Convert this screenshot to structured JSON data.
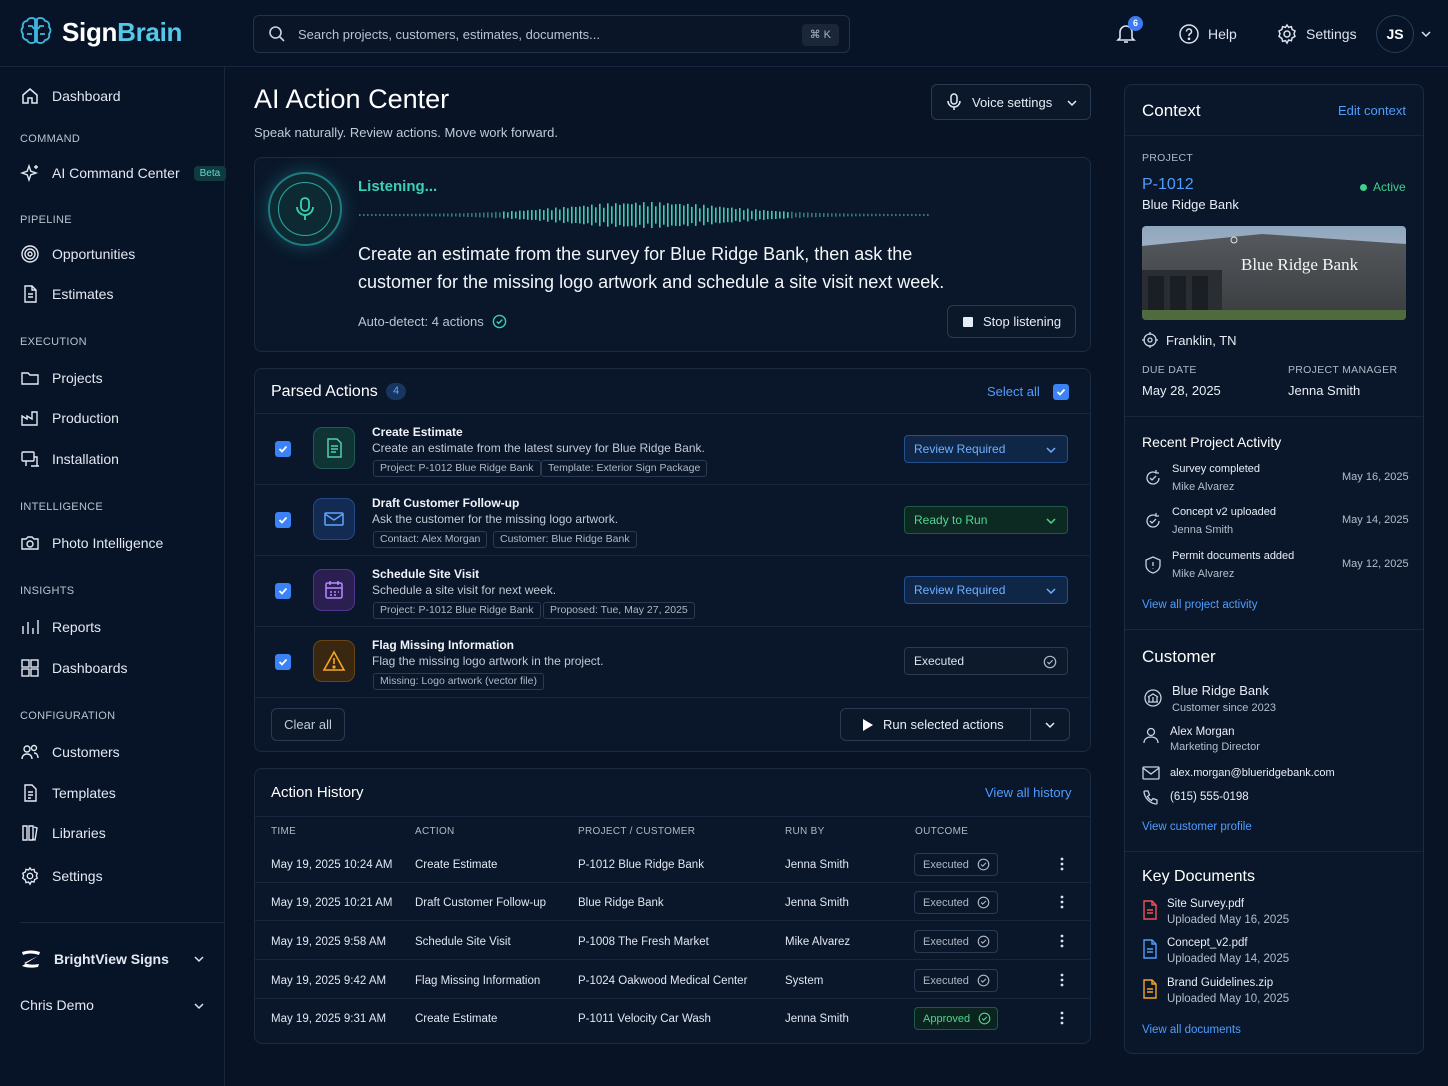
{
  "brand": {
    "name_part1": "Sign",
    "name_part2": "Brain"
  },
  "topbar": {
    "search_placeholder": "Search projects, customers, estimates, documents...",
    "search_shortcut": "⌘ K",
    "notifications_count": "6",
    "help_label": "Help",
    "settings_label": "Settings",
    "user_initials": "JS"
  },
  "sidebar": {
    "dashboard": "Dashboard",
    "sections": {
      "command": "COMMAND",
      "pipeline": "PIPELINE",
      "execution": "EXECUTION",
      "intelligence": "INTELLIGENCE",
      "insights": "INSIGHTS",
      "configuration": "CONFIGURATION"
    },
    "items": {
      "ai_command_center": "AI Command Center",
      "beta": "Beta",
      "opportunities": "Opportunities",
      "estimates": "Estimates",
      "projects": "Projects",
      "production": "Production",
      "installation": "Installation",
      "photo_intelligence": "Photo Intelligence",
      "reports": "Reports",
      "dashboards": "Dashboards",
      "customers": "Customers",
      "templates": "Templates",
      "libraries": "Libraries",
      "settings": "Settings"
    },
    "org_name": "BrightView Signs",
    "user_name": "Chris Demo"
  },
  "main": {
    "title": "AI Action Center",
    "subtitle": "Speak naturally. Review actions. Move work forward.",
    "voice_settings": "Voice settings",
    "listening": {
      "status": "Listening...",
      "transcript": "Create an estimate from the survey for Blue Ridge Bank, then ask the customer for the missing logo artwork and schedule a site visit next week.",
      "auto_detect": "Auto-detect: 4 actions",
      "stop_button": "Stop listening"
    },
    "parsed_actions": {
      "title": "Parsed Actions",
      "count": "4",
      "select_all": "Select all",
      "items": [
        {
          "title": "Create Estimate",
          "desc": "Create an estimate from the latest survey for Blue Ridge Bank.",
          "tag1": "Project: P-1012 Blue Ridge Bank",
          "tag2": "Template: Exterior Sign Package",
          "status": "Review Required"
        },
        {
          "title": "Draft Customer Follow-up",
          "desc": "Ask the customer for the missing logo artwork.",
          "tag1": "Contact: Alex Morgan",
          "tag2": "Customer: Blue Ridge Bank",
          "status": "Ready to Run"
        },
        {
          "title": "Schedule Site Visit",
          "desc": "Schedule a site visit for next week.",
          "tag1": "Project: P-1012 Blue Ridge Bank",
          "tag2": "Proposed: Tue, May 27, 2025",
          "status": "Review Required"
        },
        {
          "title": "Flag Missing Information",
          "desc": "Flag the missing logo artwork in the project.",
          "tag1": "Missing: Logo artwork (vector file)",
          "status": "Executed"
        }
      ],
      "clear_all": "Clear all",
      "run_selected": "Run selected actions"
    },
    "history": {
      "title": "Action History",
      "view_all": "View all history",
      "headers": [
        "TIME",
        "ACTION",
        "PROJECT / CUSTOMER",
        "RUN BY",
        "OUTCOME"
      ],
      "rows": [
        {
          "time": "May 19, 2025  10:24 AM",
          "action": "Create Estimate",
          "project": "P-1012  Blue Ridge Bank",
          "run_by": "Jenna Smith",
          "outcome": "Executed"
        },
        {
          "time": "May 19, 2025  10:21 AM",
          "action": "Draft Customer Follow-up",
          "project": "Blue Ridge Bank",
          "run_by": "Jenna Smith",
          "outcome": "Executed"
        },
        {
          "time": "May 19, 2025  9:58 AM",
          "action": "Schedule Site Visit",
          "project": "P-1008  The Fresh Market",
          "run_by": "Mike Alvarez",
          "outcome": "Executed"
        },
        {
          "time": "May 19, 2025  9:42 AM",
          "action": "Flag Missing Information",
          "project": "P-1024  Oakwood Medical Center",
          "run_by": "System",
          "outcome": "Executed"
        },
        {
          "time": "May 19, 2025  9:31 AM",
          "action": "Create Estimate",
          "project": "P-1011   Velocity Car Wash",
          "run_by": "Jenna Smith",
          "outcome": "Approved"
        }
      ]
    }
  },
  "context": {
    "title": "Context",
    "edit": "Edit context",
    "project_label": "PROJECT",
    "project_id": "P-1012",
    "project_status": "Active",
    "project_name": "Blue Ridge Bank",
    "image_sign_text": "Blue Ridge Bank",
    "location": "Franklin, TN",
    "due_label": "DUE DATE",
    "due_date": "May 28, 2025",
    "pm_label": "PROJECT MANAGER",
    "pm_name": "Jenna Smith",
    "activity_title": "Recent Project Activity",
    "activity": [
      {
        "title": "Survey completed",
        "who": "Mike Alvarez",
        "date": "May 16, 2025"
      },
      {
        "title": "Concept v2 uploaded",
        "who": "Jenna Smith",
        "date": "May 14, 2025"
      },
      {
        "title": "Permit documents added",
        "who": "Mike Alvarez",
        "date": "May 12, 2025"
      }
    ],
    "activity_link": "View all project activity",
    "customer_title": "Customer",
    "customer_name": "Blue Ridge Bank",
    "customer_since": "Customer since 2023",
    "contact_name": "Alex Morgan",
    "contact_role": "Marketing Director",
    "email": "alex.morgan@blueridgebank.com",
    "phone": "(615) 555-0198",
    "customer_link": "View customer profile",
    "docs_title": "Key Documents",
    "docs": [
      {
        "name": "Site Survey.pdf",
        "uploaded": "Uploaded May 16, 2025"
      },
      {
        "name": "Concept_v2.pdf",
        "uploaded": "Uploaded May 14, 2025"
      },
      {
        "name": "Brand Guidelines.zip",
        "uploaded": "Uploaded May 10, 2025"
      }
    ],
    "docs_link": "View all documents"
  }
}
